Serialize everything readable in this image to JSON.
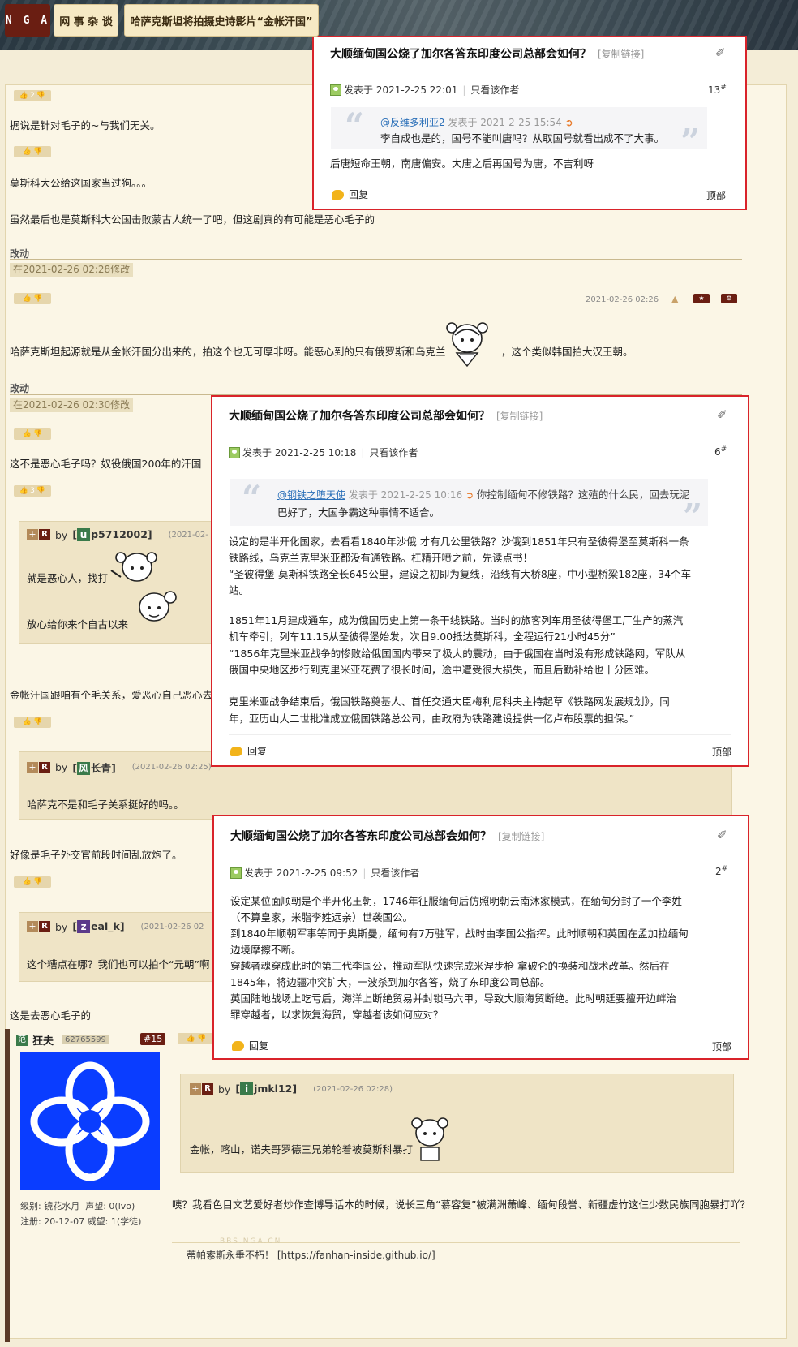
{
  "header": {
    "logo": "N G A",
    "forum": "网 事 杂 谈",
    "thread_title": "哈萨克斯坦将拍摄史诗影片“金帐汗国”"
  },
  "thread": {
    "vote1": "2",
    "line1": "据说是针对毛子的~与我们无关。",
    "line2": "莫斯科大公给这国家当过狗。。。",
    "line3": "虽然最后也是莫斯科大公国击败蒙古人统一了吧，但这剧真的有可能是恶心毛子的",
    "edited1": "改动",
    "edit_stamp1": "在2021-02-26 02:28修改",
    "time_a": "2021-02-26 02:26",
    "line4a": "哈萨克斯坦起源就是从金帐汗国分出来的，拍这个也无可厚非呀。能恶心到的只有俄罗斯和乌克兰",
    "line4b": "，这个类似韩国拍大汉王朝。",
    "edited2": "改动",
    "edit_stamp2": "在2021-02-26 02:30修改",
    "line5": "这不是恶心毛子吗？奴役俄国200年的汗国",
    "vote2": "3",
    "quote1": {
      "by": "by",
      "letter": "u",
      "name": "p5712002]",
      "date": "(2021-02-",
      "l1": "就是恶心人，找打",
      "l2": "放心给你来个自古以来"
    },
    "line6": "金帐汗国跟咱有个毛关系，爱恶心自己恶心去",
    "quote2": {
      "by": "by",
      "letter": "风",
      "name": "长青]",
      "date": "(2021-02-26 02:25)",
      "text": "哈萨克不是和毛子关系挺好的吗。。"
    },
    "line7": "好像是毛子外交官前段时间乱放炮了。",
    "quote3": {
      "by": "by",
      "letter": "z",
      "name": "eal_k]",
      "date": "(2021-02-26 02",
      "text": "这个糟点在哪？我们也可以拍个“元朝”啊"
    },
    "line8": "这是去恶心毛子的",
    "user": {
      "name": "狂夫",
      "uid": "62765599",
      "floor": "#15",
      "level": "级别: 镜花水月",
      "fame": "声望: 0(lvo)",
      "reg": "注册: 20-12-07",
      "rep": "威望: 1(学徒)"
    },
    "quote4": {
      "by": "by",
      "letter": "i",
      "name": "jmkl12]",
      "date": "(2021-02-26 02:28)",
      "text": "金帐，喀山，诺夫哥罗德三兄弟轮着被莫斯科暴打"
    },
    "reply_long": "咦？我看色目文艺爱好者炒作查博导话本的时候，说长三角“慕容复”被满洲萧峰、缅甸段誉、新疆虚竹这仨少数民族同胞暴打吖？",
    "watermark": "BBS.NGA.CN",
    "signature_pre": "蒂帕索斯永垂不朽！ [",
    "signature_link": "https://fanhan-inside.github.io/",
    "signature_post": "]"
  },
  "popups": [
    {
      "title": "大顺缅甸国公烧了加尔各答东印度公司总部会如何？",
      "copy": "[复制链接]",
      "posted_label": "发表于",
      "posted": "2021-2-25 22:01",
      "only_author": "只看该作者",
      "floor": "13",
      "quote_user": "@反维多利亚2",
      "quote_meta": "发表于 2021-2-25 15:54",
      "quote_text": "李自成也是的，国号不能叫唐吗？从取国号就看出成不了大事。",
      "body": [
        "后唐短命王朝，南唐偏安。大唐之后再国号为唐，不吉利呀"
      ],
      "reply": "回复",
      "top": "顶部"
    },
    {
      "title": "大顺缅甸国公烧了加尔各答东印度公司总部会如何？",
      "copy": "[复制链接]",
      "posted_label": "发表于",
      "posted": "2021-2-25 10:18",
      "only_author": "只看该作者",
      "floor": "6",
      "quote_user": "@钢铁之堕天使",
      "quote_meta": "发表于 2021-2-25 10:16",
      "quote_text": "你控制缅甸不修铁路？这殖的什么民，回去玩泥",
      "quote_text2": "巴好了，大国争霸这种事情不适合。",
      "body": [
        "设定的是半开化国家，去看看1840年沙俄 才有几公里铁路？沙俄到1851年只有圣彼得堡至莫斯科一条",
        "铁路线，乌克兰克里米亚都没有通铁路。杠精开喷之前，先读点书！",
        "“圣彼得堡-莫斯科铁路全长645公里，建设之初即为复线，沿线有大桥8座，中小型桥梁182座，34个车",
        "站。",
        "",
        "1851年11月建成通车，成为俄国历史上第一条干线铁路。当时的旅客列车用圣彼得堡工厂生产的蒸汽",
        "机车牵引，列车11.15从圣彼得堡始发，次日9.00抵达莫斯科，全程运行21小时45分”",
        "“1856年克里米亚战争的惨败给俄国国内带来了极大的震动，由于俄国在当时没有形成铁路网，军队从",
        "俄国中央地区步行到克里米亚花费了很长时间，途中遭受很大损失，而且后勤补给也十分困难。",
        "",
        "克里米亚战争结束后，俄国铁路奠基人、首任交通大臣梅利尼科夫主持起草《铁路网发展规划》，同",
        "年，亚历山大二世批准成立俄国铁路总公司，由政府为铁路建设提供一亿卢布股票的担保。”"
      ],
      "reply": "回复",
      "top": "顶部"
    },
    {
      "title": "大顺缅甸国公烧了加尔各答东印度公司总部会如何？",
      "copy": "[复制链接]",
      "posted_label": "发表于",
      "posted": "2021-2-25 09:52",
      "only_author": "只看该作者",
      "floor": "2",
      "body": [
        "设定某位面顺朝是个半开化王朝，1746年征服缅甸后仿照明朝云南沐家模式，在缅甸分封了一个李姓",
        "（不算皇家，米脂李姓远亲）世袭国公。",
        "到1840年顺朝军事等同于奥斯曼，缅甸有7万驻军，战时由李国公指挥。此时顺朝和英国在孟加拉缅甸",
        "边境摩擦不断。",
        "穿越者魂穿成此时的第三代李国公，推动军队快速完成米涅步枪 拿破仑的换装和战术改革。然后在",
        "1845年，将边疆冲突扩大，一波杀到加尔各答，烧了东印度公司总部。",
        "英国陆地战场上吃亏后，海洋上断绝贸易并封锁马六甲，导致大顺海贸断绝。此时朝廷要擅开边衅治",
        "罪穿越者，以求恢复海贸，穿越者该如何应对？"
      ],
      "reply": "回复",
      "top": "顶部"
    }
  ]
}
